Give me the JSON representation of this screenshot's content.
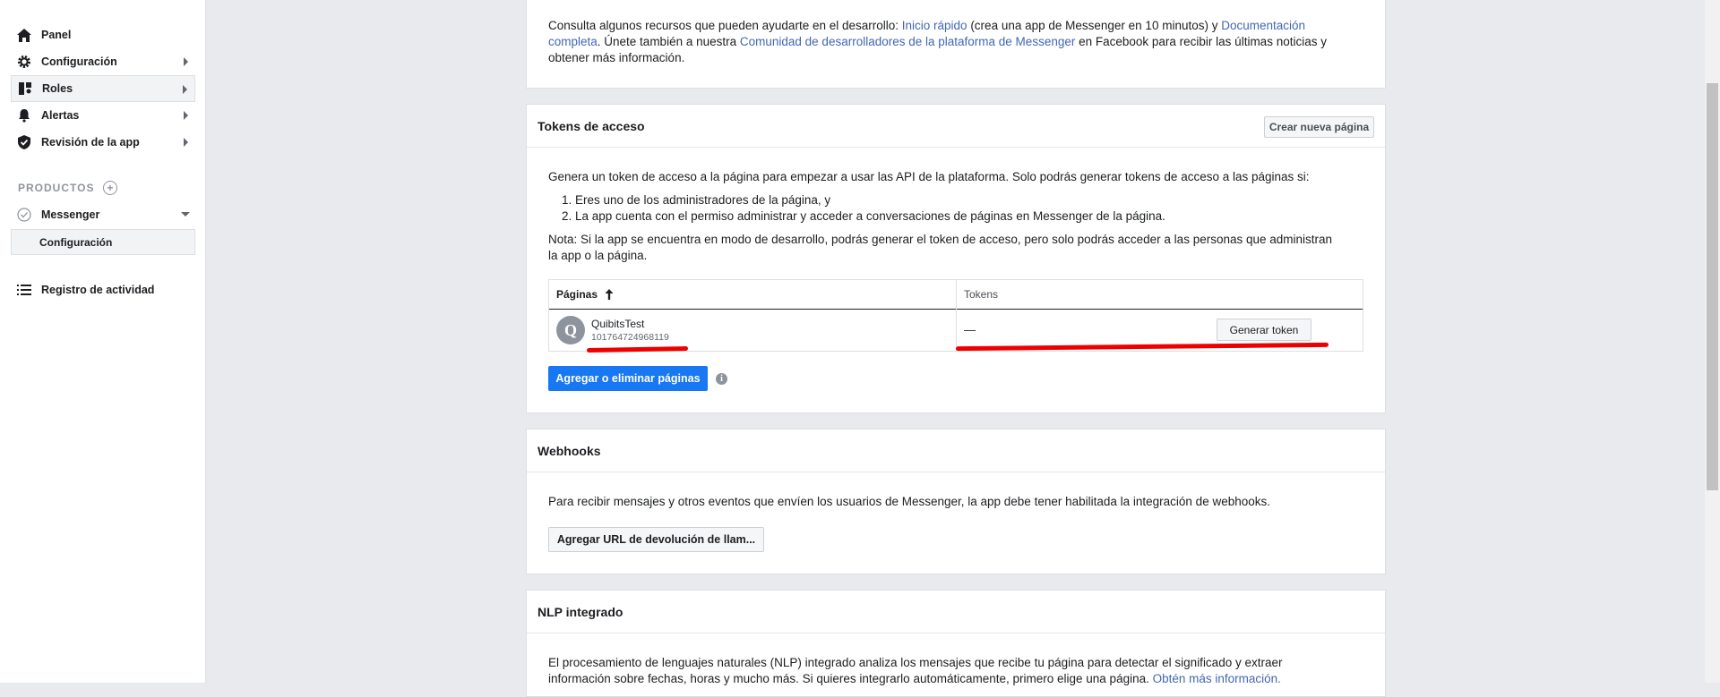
{
  "sidebar": {
    "items": [
      {
        "label": "Panel",
        "icon": "home-icon"
      },
      {
        "label": "Configuración",
        "icon": "gear-icon"
      },
      {
        "label": "Roles",
        "icon": "roles-icon"
      },
      {
        "label": "Alertas",
        "icon": "bell-icon"
      },
      {
        "label": "Revisión de la app",
        "icon": "shield-check-icon"
      }
    ],
    "products_label": "PRODUCTOS",
    "product": {
      "label": "Messenger",
      "sub_item": "Configuración"
    },
    "activity_log": "Registro de actividad"
  },
  "resources": {
    "text1": "Consulta algunos recursos que pueden ayudarte en el desarrollo: ",
    "link1": "Inicio rápido",
    "text2": " (crea una app de Messenger en 10 minutos) y ",
    "link2a": "Documentación",
    "link2b": "completa",
    "text3": ". Únete también a nuestra ",
    "link3": "Comunidad de desarrolladores de la plataforma de Messenger",
    "text4": " en Facebook para recibir las últimas noticias y",
    "text5": "obtener más información."
  },
  "tokens": {
    "title": "Tokens de acceso",
    "create_page_button": "Crear nueva página",
    "intro": "Genera un token de acceso a la página para empezar a usar las API de la plataforma. Solo podrás generar tokens de acceso a las páginas si:",
    "conditions": [
      "1. Eres uno de los administradores de la página, y",
      "2. La app cuenta con el permiso administrar y acceder a conversaciones de páginas en Messenger de la página."
    ],
    "note_line1": "Nota: Si la app se encuentra en modo de desarrollo, podrás generar el token de acceso, pero solo podrás acceder a las personas que administran",
    "note_line2": "la app o la página.",
    "table": {
      "col_pages": "Páginas",
      "col_tokens": "Tokens",
      "rows": [
        {
          "avatar_letter": "Q",
          "page_name": "QuibitsTest",
          "page_id": "101764724968119",
          "token": "—",
          "action": "Generar token"
        }
      ]
    },
    "add_remove_button": "Agregar o eliminar páginas"
  },
  "webhooks": {
    "title": "Webhooks",
    "description": "Para recibir mensajes y otros eventos que envíen los usuarios de Messenger, la app debe tener habilitada la integración de webhooks.",
    "callback_button": "Agregar URL de devolución de llam..."
  },
  "nlp": {
    "title": "NLP integrado",
    "line1": "El procesamiento de lenguajes naturales (NLP) integrado analiza los mensajes que recibe tu página para detectar el significado y extraer",
    "line2": "información sobre fechas, horas y mucho más. Si quieres integrarlo automáticamente, primero elige una página. ",
    "line2_link": "Obtén más información."
  },
  "colors": {
    "primary": "#1877f2",
    "link": "#4267b2",
    "annotation_red": "#ee0000"
  }
}
